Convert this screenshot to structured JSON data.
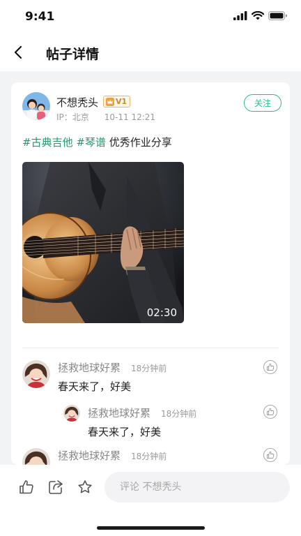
{
  "status_bar": {
    "time": "9:41",
    "icons": [
      "signal-icon",
      "wifi-icon",
      "battery-icon"
    ]
  },
  "nav": {
    "title": "帖子详情",
    "back_icon": "back-arrow-icon"
  },
  "post": {
    "author": {
      "name": "不想秃头",
      "level": "V1",
      "ip": "IP：北京",
      "time": "10-11 12:21"
    },
    "follow_label": "关注",
    "hashtags": [
      "#古典吉他",
      "#琴谱"
    ],
    "text": "优秀作业分享",
    "video": {
      "duration": "02:30",
      "subject": "guitar-video-thumbnail"
    }
  },
  "comments": [
    {
      "name": "拯救地球好累",
      "time": "18分钟前",
      "text": "春天来了，好美",
      "reply": false
    },
    {
      "name": "拯救地球好累",
      "time": "18分钟前",
      "text": "春天来了，好美",
      "reply": true
    },
    {
      "name": "拯救地球好累",
      "time": "18分钟前",
      "text": "",
      "reply": false
    }
  ],
  "bottom_bar": {
    "icons": [
      "thumbs-up-icon",
      "share-icon",
      "star-icon"
    ],
    "comment_placeholder": "评论 不想秃头"
  },
  "colors": {
    "accent": "#2fb98e",
    "hashtag": "#1f9a6b",
    "badge": "#e9b66b",
    "background": "#f2f3f5"
  }
}
